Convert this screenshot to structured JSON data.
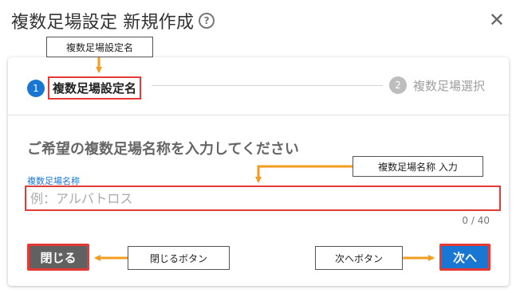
{
  "dialog": {
    "title": "複数足場設定 新規作成",
    "help_icon": "help-circle-icon",
    "close_icon": "close-icon",
    "close_glyph": "✕"
  },
  "stepper": {
    "steps": [
      {
        "number": "1",
        "label": "複数足場設定名",
        "state": "active",
        "color": "#1976d2"
      },
      {
        "number": "2",
        "label": "複数足場選択",
        "state": "inactive",
        "color": "#bdbdbd"
      }
    ]
  },
  "form": {
    "heading": "ご希望の複数足場名称を入力してください",
    "field_label": "複数足場名称",
    "placeholder": "例：アルバトロス",
    "value": "",
    "counter": "0 / 40"
  },
  "buttons": {
    "close_label": "閉じる",
    "next_label": "次へ"
  },
  "annotations": {
    "step_name": "複数足場設定名",
    "input": "複数足場名称 入力",
    "close_button": "閉じるボタン",
    "next_button": "次へボタン",
    "highlight_color": "#e53935",
    "arrow_color": "#f39c1e"
  }
}
